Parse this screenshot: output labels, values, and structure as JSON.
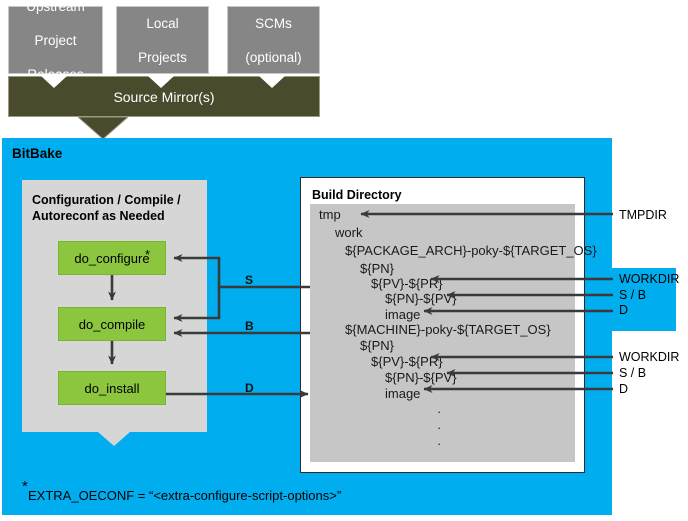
{
  "sources": [
    {
      "label": "Upstream\nProject\nReleases",
      "lines": [
        "Upstream",
        "Project",
        "Releases"
      ]
    },
    {
      "label": "Local\nProjects",
      "lines": [
        "Local",
        "Projects"
      ]
    },
    {
      "label": "SCMs\n(optional)",
      "lines": [
        "SCMs",
        "(optional)"
      ]
    }
  ],
  "source_mirror": {
    "label": "Source Mirror(s)"
  },
  "bitbake": {
    "title": "BitBake"
  },
  "config_panel": {
    "title_line1": "Configuration / Compile /",
    "title_line2": "Autoreconf as Needed",
    "tasks": [
      {
        "label": "do_configure",
        "marker": "*"
      },
      {
        "label": "do_compile",
        "marker": ""
      },
      {
        "label": "do_install",
        "marker": ""
      }
    ]
  },
  "flow_labels": {
    "s": "S",
    "b": "B",
    "d": "D"
  },
  "build_directory": {
    "title": "Build Directory",
    "tree": [
      {
        "text": "tmp",
        "indent": 0
      },
      {
        "text": "work",
        "indent": 1
      },
      {
        "text": "${PACKAGE_ARCH}-poky-${TARGET_OS}",
        "indent": 2
      },
      {
        "text": "${PN}",
        "indent": 3
      },
      {
        "text": "${PV}-${PR}",
        "indent": 4
      },
      {
        "text": "${PN}-${PV}",
        "indent": 5
      },
      {
        "text": "image",
        "indent": 5
      },
      {
        "text": "${MACHINE}-poky-${TARGET_OS}",
        "indent": 2
      },
      {
        "text": "${PN}",
        "indent": 3
      },
      {
        "text": "${PV}-${PR}",
        "indent": 4
      },
      {
        "text": "${PN}-${PV}",
        "indent": 5
      },
      {
        "text": "image",
        "indent": 5
      }
    ],
    "ellipsis": [
      "·",
      "·",
      "·"
    ]
  },
  "right_labels": [
    {
      "text": "TMPDIR"
    },
    {
      "text": "WORKDIR"
    },
    {
      "text": "S / B"
    },
    {
      "text": "D"
    },
    {
      "text": "WORKDIR"
    },
    {
      "text": "S / B"
    },
    {
      "text": "D"
    }
  ],
  "footnote": {
    "marker": "*",
    "text": "EXTRA_OECONF = “<extra-configure-script-options>”"
  },
  "colors": {
    "bitbake_blue": "#00AEEF",
    "source_grey": "#868686",
    "mirror_olive": "#4A4A2D",
    "task_green": "#8CC63E",
    "panel_grey": "#D6D6D6",
    "tree_grey": "#C6C6C6",
    "arrow_dark": "#3A3A3A"
  }
}
